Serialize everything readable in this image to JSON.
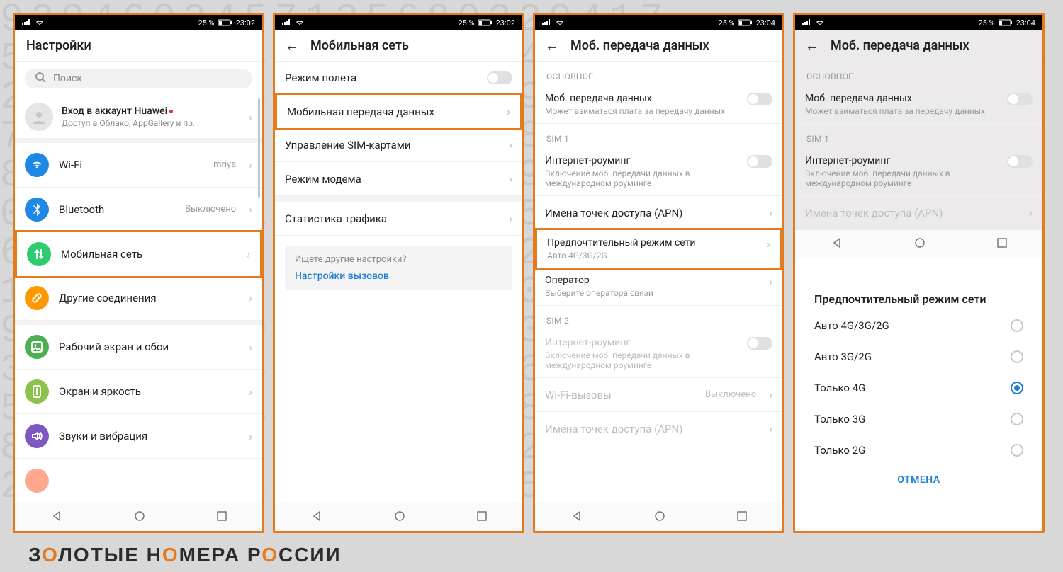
{
  "statusbar": {
    "battery_pct": "25 %",
    "time1": "23:02",
    "time2": "23:04"
  },
  "colors": {
    "wifi": "#1e88e5",
    "bt": "#1e88e5",
    "mobile": "#2ecc71",
    "other": "#ff9800",
    "wall": "#4caf50",
    "bright": "#8bc34a",
    "sound": "#7e57c2",
    "notif": "#ff7043"
  },
  "screen1": {
    "title": "Настройки",
    "search_placeholder": "Поиск",
    "account_title": "Вход в аккаунт Huawei",
    "account_sub": "Доступ в Облако, AppGallery и пр.",
    "rows": [
      {
        "label": "Wi-Fi",
        "value": "mriya"
      },
      {
        "label": "Bluetooth",
        "value": "Выключено"
      },
      {
        "label": "Мобильная сеть",
        "highlight": true
      },
      {
        "label": "Другие соединения"
      },
      {
        "label": "Рабочий экран и обои"
      },
      {
        "label": "Экран и яркость"
      },
      {
        "label": "Звуки и вибрация"
      }
    ]
  },
  "screen2": {
    "title": "Мобильная сеть",
    "rows": [
      {
        "label": "Режим полета",
        "toggle": true
      },
      {
        "label": "Мобильная передача данных",
        "highlight": true
      },
      {
        "label": "Управление SIM-картами"
      },
      {
        "label": "Режим модема"
      },
      {
        "label": "Статистика трафика"
      }
    ],
    "info_q": "Ищете другие настройки?",
    "info_link": "Настройки вызовов"
  },
  "screen3": {
    "title": "Моб. передача данных",
    "sec_main": "ОСНОВНОЕ",
    "sec_sim1": "SIM 1",
    "sec_sim2": "SIM 2",
    "mob_data": "Моб. передача данных",
    "mob_data_sub": "Может взиматься плата за передачу данных",
    "roaming": "Интернет-роуминг",
    "roaming_sub": "Включение моб. передачи данных в международном роуминге",
    "apn": "Имена точек доступа (APN)",
    "prefmode": "Предпочтительный режим сети",
    "prefmode_sub": "Авто 4G/3G/2G",
    "operator": "Оператор",
    "operator_sub": "Выберите оператора связи",
    "wifi_call": "Wi-Fi-вызовы",
    "wifi_call_val": "Выключено"
  },
  "screen4": {
    "popup_title": "Предпочтительный режим сети",
    "options": [
      "Авто 4G/3G/2G",
      "Авто 3G/2G",
      "Только 4G",
      "Только 3G",
      "Только 2G"
    ],
    "selected_index": 2,
    "cancel": "ОТМЕНА"
  },
  "footer": {
    "t1": "З",
    "t2": "ЛОТЫЕ Н",
    "t3": "МЕРА Р",
    "t4": "ССИИ"
  }
}
